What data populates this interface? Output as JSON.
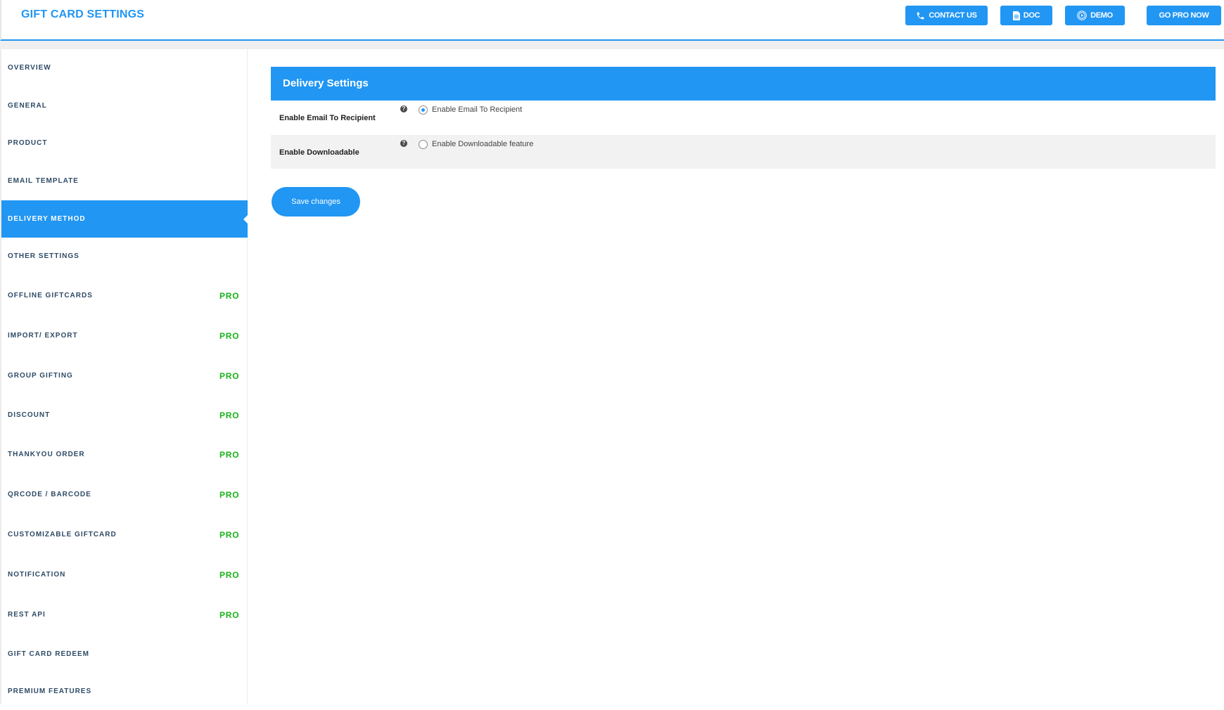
{
  "header": {
    "title": "GIFT CARD SETTINGS",
    "buttons": {
      "contact": {
        "label": "CONTACT US",
        "icon": "phone-icon"
      },
      "doc": {
        "label": "DOC",
        "icon": "document-icon"
      },
      "demo": {
        "label": "DEMO",
        "icon": "play-circle-icon"
      },
      "pro": {
        "label": "GO PRO NOW"
      }
    }
  },
  "sidebar": {
    "items": [
      {
        "label": "OVERVIEW",
        "pro": ""
      },
      {
        "label": "GENERAL",
        "pro": ""
      },
      {
        "label": "PRODUCT",
        "pro": ""
      },
      {
        "label": "EMAIL TEMPLATE",
        "pro": ""
      },
      {
        "label": "DELIVERY METHOD",
        "pro": "",
        "active": true
      },
      {
        "label": "OTHER SETTINGS",
        "pro": ""
      },
      {
        "label": "OFFLINE GIFTCARDS",
        "pro": "PRO"
      },
      {
        "label": "IMPORT/ EXPORT",
        "pro": "PRO"
      },
      {
        "label": "GROUP GIFTING",
        "pro": "PRO"
      },
      {
        "label": "DISCOUNT",
        "pro": "PRO"
      },
      {
        "label": "THANKYOU ORDER",
        "pro": "PRO"
      },
      {
        "label": "QRCODE / BARCODE",
        "pro": "PRO"
      },
      {
        "label": "CUSTOMIZABLE GIFTCARD",
        "pro": "PRO"
      },
      {
        "label": "NOTIFICATION",
        "pro": "PRO"
      },
      {
        "label": "REST API",
        "pro": "PRO"
      },
      {
        "label": "GIFT CARD REDEEM",
        "pro": ""
      },
      {
        "label": "PREMIUM FEATURES",
        "pro": ""
      }
    ]
  },
  "main": {
    "section_title": "Delivery Settings",
    "settings": [
      {
        "label": "Enable Email To Recipient",
        "option_label": "Enable Email To Recipient",
        "checked": true,
        "help": "?"
      },
      {
        "label": "Enable Downloadable",
        "option_label": "Enable Downloadable feature",
        "checked": false,
        "help": "?"
      }
    ],
    "save_label": "Save changes"
  },
  "colors": {
    "accent": "#2196f3",
    "pro_badge": "#19b319",
    "sidebar_text": "#2e4a66"
  }
}
